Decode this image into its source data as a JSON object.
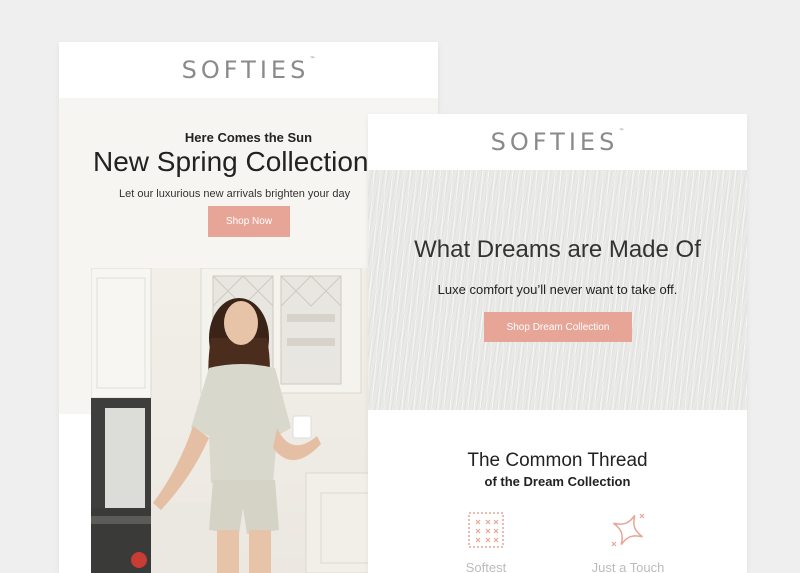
{
  "email_left": {
    "brand": "SOFTIES",
    "eyebrow": "Here Comes the Sun",
    "headline": "New Spring Collection",
    "subtext": "Let our luxurious new arrivals brighten your day",
    "cta_label": "Shop Now"
  },
  "email_right": {
    "brand": "SOFTIES",
    "headline": "What Dreams are Made Of",
    "subtext": "Luxe comfort you’ll never want to take off.",
    "cta_label": "Shop Dream Collection",
    "section_title": "The Common Thread",
    "section_subtitle": "of the Dream Collection",
    "features": [
      {
        "icon": "fabric-swatch-icon",
        "label": "Softest"
      },
      {
        "icon": "sparkle-icon",
        "label": "Just a Touch"
      }
    ]
  },
  "colors": {
    "accent": "#e7a597",
    "background": "#efefef",
    "hero_cream": "#f6f5f1",
    "logo_gray": "#8a8a8a"
  }
}
